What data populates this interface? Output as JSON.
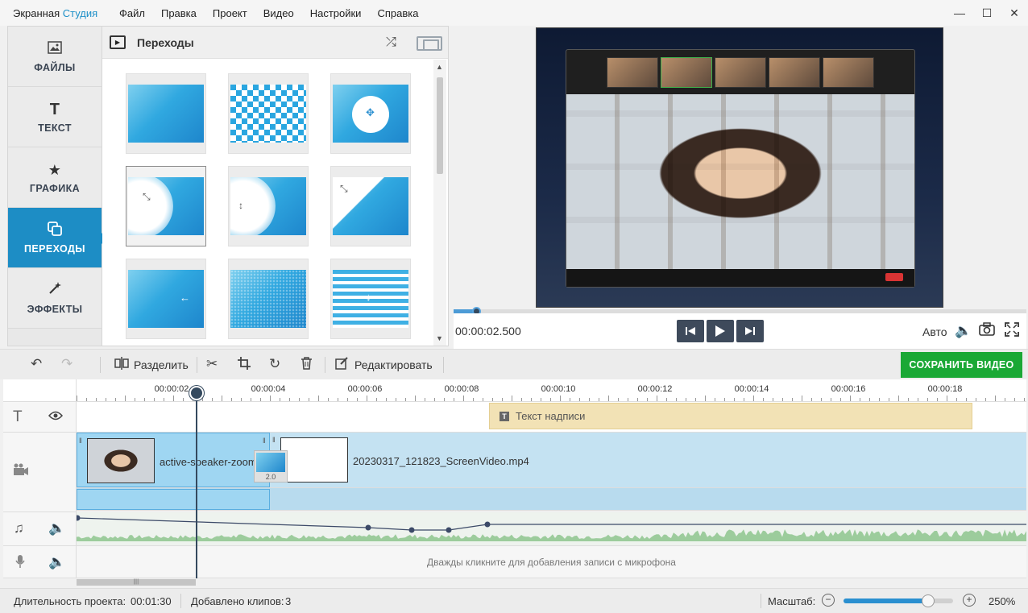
{
  "app": {
    "title_part1": "Экранная ",
    "title_part2": "Студия",
    "accent": "#1e90c8"
  },
  "menu": [
    "Файл",
    "Правка",
    "Проект",
    "Видео",
    "Настройки",
    "Справка"
  ],
  "window_controls": {
    "minimize": "—",
    "maximize": "☐",
    "close": "✕"
  },
  "sidebar": {
    "items": [
      {
        "label": "ФАЙЛЫ",
        "icon": "image-icon"
      },
      {
        "label": "ТЕКСТ",
        "icon": "text-icon"
      },
      {
        "label": "ГРАФИКА",
        "icon": "star-icon"
      },
      {
        "label": "ПЕРЕХОДЫ",
        "icon": "transitions-icon",
        "active": true
      },
      {
        "label": "ЭФФЕКТЫ",
        "icon": "magic-wand-icon"
      }
    ],
    "active_color": "#1d8dc5"
  },
  "transitions_panel": {
    "title": "Переходы",
    "selected_index": 3
  },
  "preview": {
    "timecode": "00:00:02.500",
    "progress": 0.04,
    "quality_label": "Авто"
  },
  "toolbar": {
    "split_label": "Разделить",
    "edit_label": "Редактировать",
    "save_label": "СОХРАНИТЬ ВИДЕО",
    "save_color": "#1aa835"
  },
  "timeline": {
    "ruler_labels": [
      "00:00:02",
      "00:00:04",
      "00:00:06",
      "00:00:08",
      "00:00:10",
      "00:00:12",
      "00:00:14",
      "00:00:16",
      "00:00:18"
    ],
    "caption_clip": "Текст надписи",
    "clip1_name": "active-speaker-zoom",
    "clip2_name": "20230317_121823_ScreenVideo.mp4",
    "transition_duration": "2.0",
    "mic_hint": "Дважды кликните для добавления записи с микрофона",
    "playhead_time": "00:00:02.500"
  },
  "status": {
    "duration_label": "Длительность проекта:",
    "duration_value": "00:01:30",
    "clips_label": "Добавлено клипов:",
    "clips_value": "3",
    "scale_label": "Масштаб:",
    "scale_value": "250%",
    "scale_fraction": 0.77
  }
}
